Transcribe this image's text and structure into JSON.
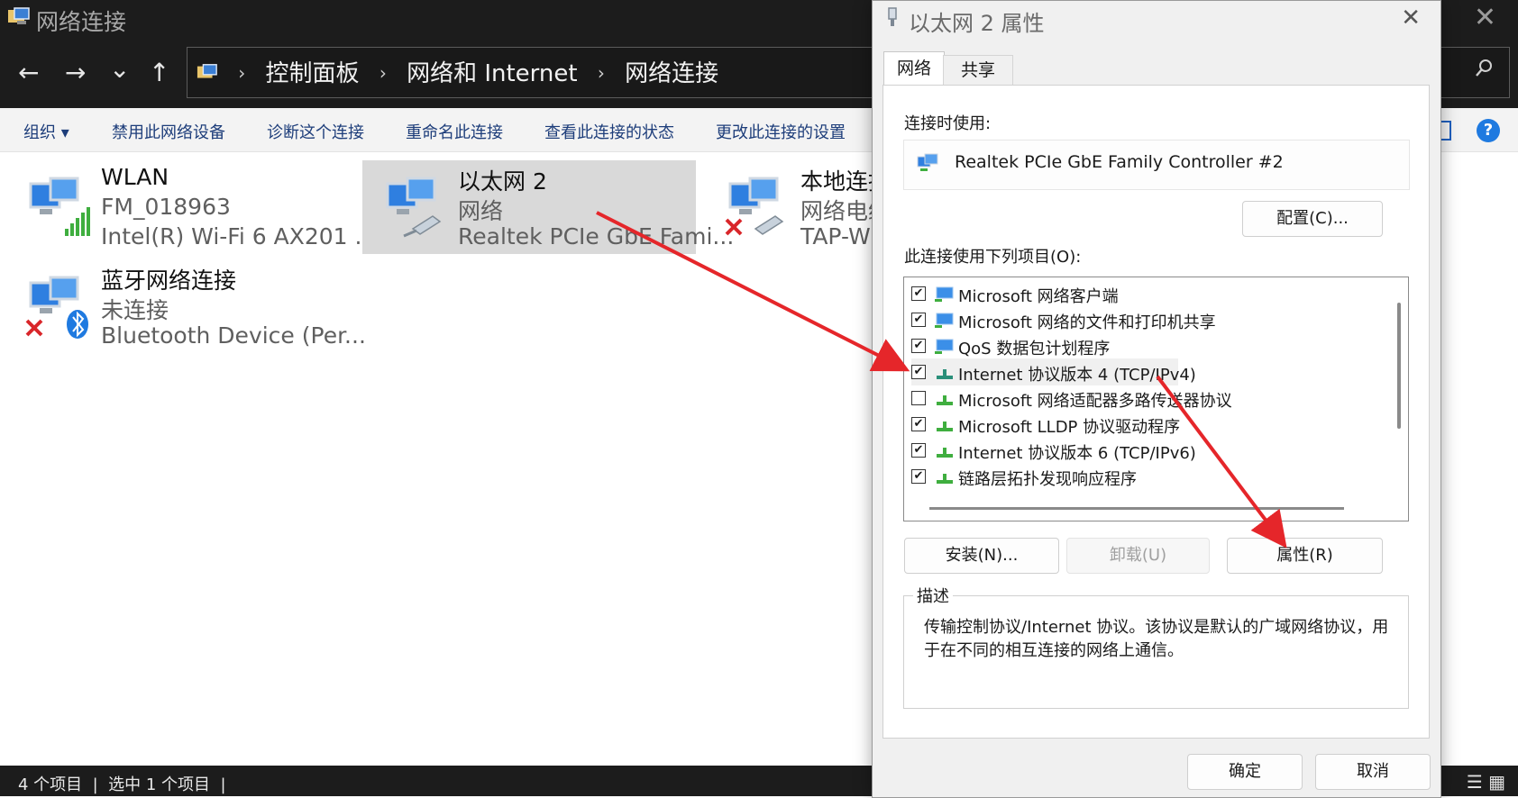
{
  "window": {
    "title": "网络连接",
    "close_glyph": "✕"
  },
  "nav": {
    "back": "←",
    "forward": "→",
    "recent": "⌄",
    "up": "↑"
  },
  "address": {
    "crumbs": [
      "控制面板",
      "网络和 Internet",
      "网络连接"
    ],
    "separator": "›"
  },
  "commands": [
    "组织 ▾",
    "禁用此网络设备",
    "诊断这个连接",
    "重命名此连接",
    "查看此连接的状态",
    "更改此连接的设置"
  ],
  "help": "?",
  "connections": [
    {
      "name": "WLAN",
      "status": "FM_018963",
      "device": "Intel(R) Wi-Fi 6 AX201 ...",
      "icon": "wifi-adapter-icon",
      "selected": false
    },
    {
      "name": "以太网 2",
      "status": "网络",
      "device": "Realtek PCIe GbE Fami...",
      "icon": "ethernet-adapter-icon",
      "selected": true
    },
    {
      "name": "本地连接",
      "status": "网络电缆",
      "device": "TAP-Win",
      "icon": "ethernet-disconnected-icon",
      "selected": false
    },
    {
      "name": "蓝牙网络连接",
      "status": "未连接",
      "device": "Bluetooth Device (Per...",
      "icon": "bluetooth-adapter-icon",
      "selected": false
    }
  ],
  "statusbar": {
    "text": "4 个项目  |  选中 1 个项目  |"
  },
  "dialog": {
    "title": "以太网 2 属性",
    "close_glyph": "✕",
    "tabs": [
      "网络",
      "共享"
    ],
    "connect_using_label": "连接时使用:",
    "adapter_name": "Realtek PCIe GbE Family Controller #2",
    "configure_button": "配置(C)...",
    "items_label": "此连接使用下列项目(O):",
    "items": [
      {
        "label": "Microsoft 网络客户端",
        "checked": true,
        "icon": "network-client-icon"
      },
      {
        "label": "Microsoft 网络的文件和打印机共享",
        "checked": true,
        "icon": "network-client-icon"
      },
      {
        "label": "QoS 数据包计划程序",
        "checked": true,
        "icon": "network-client-icon"
      },
      {
        "label": "Internet 协议版本 4 (TCP/IPv4)",
        "checked": true,
        "icon": "protocol-icon"
      },
      {
        "label": "Microsoft 网络适配器多路传送器协议",
        "checked": false,
        "icon": "protocol-icon"
      },
      {
        "label": "Microsoft LLDP 协议驱动程序",
        "checked": true,
        "icon": "protocol-icon"
      },
      {
        "label": "Internet 协议版本 6 (TCP/IPv6)",
        "checked": true,
        "icon": "protocol-icon"
      },
      {
        "label": "链路层拓扑发现响应程序",
        "checked": true,
        "icon": "protocol-icon"
      }
    ],
    "install_button": "安装(N)...",
    "uninstall_button": "卸载(U)",
    "properties_button": "属性(R)",
    "description_legend": "描述",
    "description_text": "传输控制协议/Internet 协议。该协议是默认的广域网络协议，用于在不同的相互连接的网络上通信。",
    "ok_button": "确定",
    "cancel_button": "取消",
    "check_glyph": "✔"
  },
  "annotation": {
    "arrow_color": "#e5262a"
  }
}
